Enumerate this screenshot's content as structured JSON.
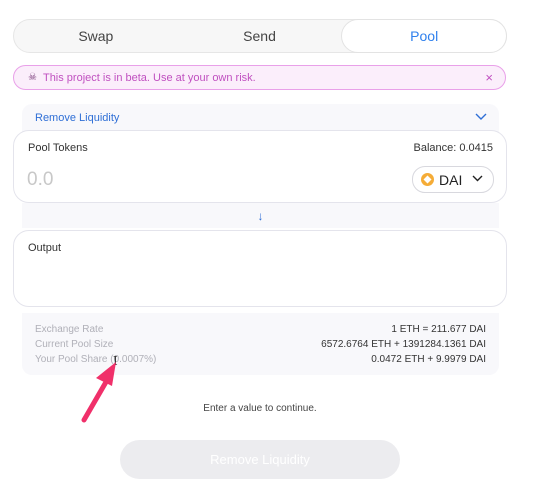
{
  "tabs": [
    {
      "label": "Swap",
      "active": false
    },
    {
      "label": "Send",
      "active": false
    },
    {
      "label": "Pool",
      "active": true
    }
  ],
  "beta_banner": {
    "icon": "skull-icon",
    "text": "This project is in beta. Use at your own risk.",
    "close": "×"
  },
  "mode_select": {
    "label": "Remove Liquidity",
    "icon": "chevron-down-icon"
  },
  "input_card": {
    "label": "Pool Tokens",
    "balance": "Balance: 0.0415",
    "placeholder": "0.0",
    "token": {
      "symbol": "DAI",
      "icon": "dai-icon",
      "color": "#f5ac37"
    }
  },
  "arrow": {
    "icon": "arrow-down-icon",
    "glyph": "↓"
  },
  "output_card": {
    "label": "Output"
  },
  "details": [
    {
      "key": "Exchange Rate",
      "value": "1 ETH = 211.677 DAI"
    },
    {
      "key": "Current Pool Size",
      "value": "6572.6764 ETH + 1391284.1361 DAI"
    },
    {
      "key": "Your Pool Share (0.0007%)",
      "value": "0.0472 ETH + 9.9979 DAI"
    }
  ],
  "hint": "Enter a value to continue.",
  "submit_label": "Remove Liquidity",
  "colors": {
    "accent": "#2f80ed",
    "beta_border": "#e9a0e9",
    "beta_text": "#c050c0",
    "pointer": "#f0306a"
  }
}
